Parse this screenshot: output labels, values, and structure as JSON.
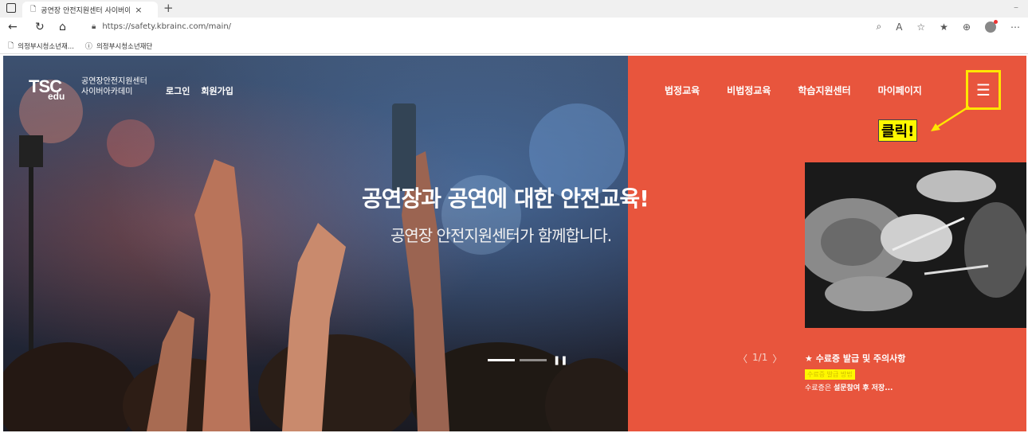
{
  "browser": {
    "tab_title": "공연장 안전지원센터 사이버아카",
    "tab_close": "×",
    "new_tab": "+",
    "url": "https://safety.kbrainc.com/main/",
    "bookmarks": [
      "의정부시청소년재...",
      "의정부시청소년재단"
    ]
  },
  "header": {
    "logo_text": "TSC",
    "logo_edu": "edu",
    "logo_sub_1": "공연장안전지원센터",
    "logo_sub_2": "사이버아카데미",
    "login": "로그인",
    "signup": "회원가입",
    "nav": [
      "법정교육",
      "비법정교육",
      "학습지원센터",
      "마이페이지"
    ],
    "menu_icon": "☰"
  },
  "hero": {
    "title": "공연장과 공연에 대한 안전교육!",
    "subtitle": "공연장 안전지원센터가 함께합니다."
  },
  "annotation": {
    "callout": "클릭!"
  },
  "notice": {
    "pager_prev": "〈",
    "pager_text": "1/1",
    "pager_next": "〉",
    "title": "★ 수료증 발급 및 주의사항",
    "highlight": "수료증 발급 방법",
    "line_prefix": "수료증은 ",
    "line_bold": "설문참여 후 저장..."
  },
  "colors": {
    "accent": "#e8553d",
    "highlight": "#fff700"
  }
}
